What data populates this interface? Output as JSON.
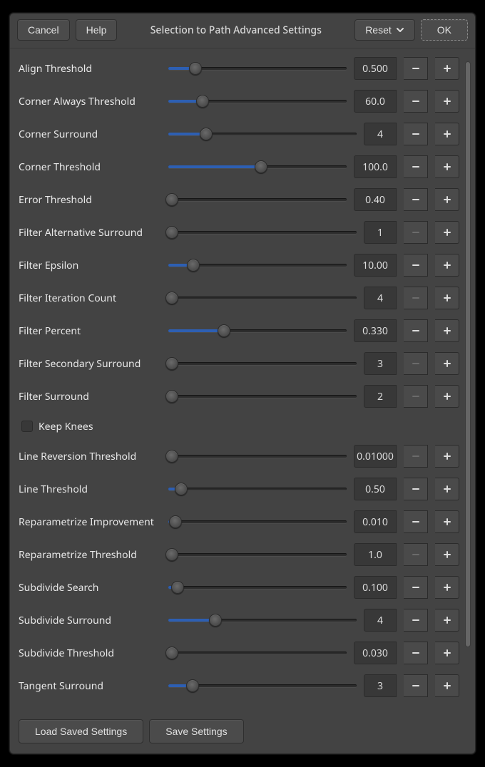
{
  "header": {
    "cancel": "Cancel",
    "help": "Help",
    "title": "Selection to Path Advanced Settings",
    "reset": "Reset",
    "ok": "OK"
  },
  "footer": {
    "load": "Load Saved Settings",
    "save": "Save Settings"
  },
  "checkbox": {
    "keep_knees": "Keep Knees"
  },
  "params": [
    {
      "id": "align-threshold",
      "label": "Align Threshold",
      "value": "0.500",
      "pos": 15,
      "narrow": false,
      "minus_disabled": false
    },
    {
      "id": "corner-always-threshold",
      "label": "Corner Always Threshold",
      "value": "60.0",
      "pos": 19,
      "narrow": false,
      "minus_disabled": false
    },
    {
      "id": "corner-surround",
      "label": "Corner Surround",
      "value": "4",
      "pos": 20,
      "narrow": true,
      "minus_disabled": false
    },
    {
      "id": "corner-threshold",
      "label": "Corner Threshold",
      "value": "100.0",
      "pos": 52,
      "narrow": false,
      "minus_disabled": false
    },
    {
      "id": "error-threshold",
      "label": "Error Threshold",
      "value": "0.40",
      "pos": 2,
      "narrow": false,
      "minus_disabled": false
    },
    {
      "id": "filter-alternative-surround",
      "label": "Filter Alternative Surround",
      "value": "1",
      "pos": 2,
      "narrow": true,
      "minus_disabled": true
    },
    {
      "id": "filter-epsilon",
      "label": "Filter Epsilon",
      "value": "10.00",
      "pos": 14,
      "narrow": false,
      "minus_disabled": false
    },
    {
      "id": "filter-iteration-count",
      "label": "Filter Iteration Count",
      "value": "4",
      "pos": 2,
      "narrow": true,
      "minus_disabled": true
    },
    {
      "id": "filter-percent",
      "label": "Filter Percent",
      "value": "0.330",
      "pos": 31,
      "narrow": false,
      "minus_disabled": false
    },
    {
      "id": "filter-secondary-surround",
      "label": "Filter Secondary Surround",
      "value": "3",
      "pos": 2,
      "narrow": true,
      "minus_disabled": true
    },
    {
      "id": "filter-surround",
      "label": "Filter Surround",
      "value": "2",
      "pos": 2,
      "narrow": true,
      "minus_disabled": true
    },
    {
      "_checkbox": "keep_knees"
    },
    {
      "id": "line-reversion-threshold",
      "label": "Line Reversion Threshold",
      "value": "0.01000",
      "pos": 2,
      "narrow": false,
      "minus_disabled": true
    },
    {
      "id": "line-threshold",
      "label": "Line Threshold",
      "value": "0.50",
      "pos": 7,
      "narrow": false,
      "minus_disabled": false
    },
    {
      "id": "reparametrize-improvement",
      "label": "Reparametrize Improvement",
      "value": "0.010",
      "pos": 4,
      "narrow": false,
      "minus_disabled": false
    },
    {
      "id": "reparametrize-threshold",
      "label": "Reparametrize Threshold",
      "value": "1.0",
      "pos": 2,
      "narrow": false,
      "minus_disabled": true
    },
    {
      "id": "subdivide-search",
      "label": "Subdivide Search",
      "value": "0.100",
      "pos": 5,
      "narrow": false,
      "minus_disabled": false
    },
    {
      "id": "subdivide-surround",
      "label": "Subdivide Surround",
      "value": "4",
      "pos": 25,
      "narrow": true,
      "minus_disabled": false
    },
    {
      "id": "subdivide-threshold",
      "label": "Subdivide Threshold",
      "value": "0.030",
      "pos": 2,
      "narrow": false,
      "minus_disabled": false
    },
    {
      "id": "tangent-surround",
      "label": "Tangent Surround",
      "value": "3",
      "pos": 13,
      "narrow": true,
      "minus_disabled": false
    }
  ]
}
